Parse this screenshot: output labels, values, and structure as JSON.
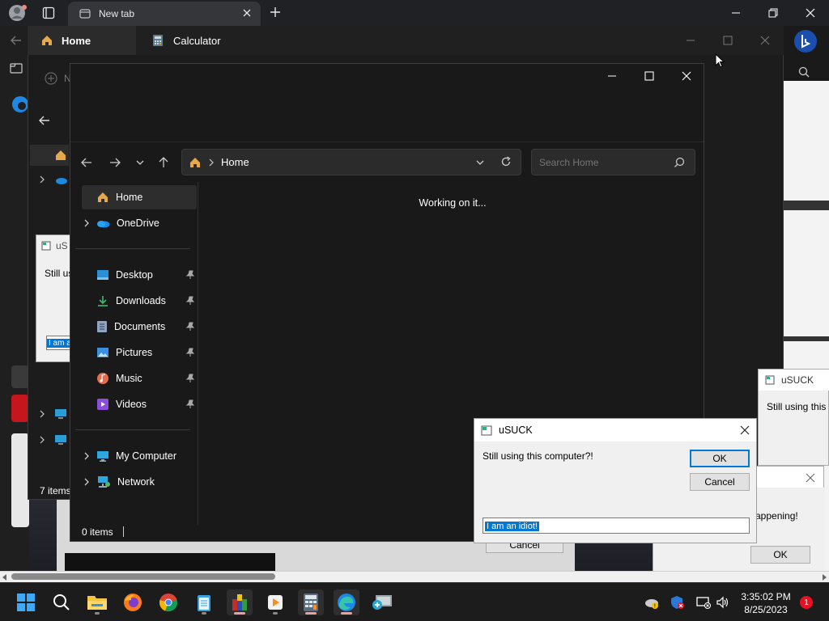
{
  "browser": {
    "tab_title": "New tab",
    "left_partial_label": "N"
  },
  "calculator_window": {
    "home_tab": "Home",
    "title": "Calculator"
  },
  "explorer": {
    "address_location": "Home",
    "search_placeholder": "Search Home",
    "status_text": "Working on it...",
    "item_count": "0 items",
    "nav_items": {
      "home": "Home",
      "onedrive": "OneDrive",
      "desktop": "Desktop",
      "downloads": "Downloads",
      "documents": "Documents",
      "pictures": "Pictures",
      "music": "Music",
      "videos": "Videos",
      "my_computer": "My Computer",
      "network": "Network"
    }
  },
  "background_explorer": {
    "item_count": "7 items"
  },
  "dialog": {
    "title": "uSUCK",
    "message": "Still using this computer?!",
    "ok_label": "OK",
    "cancel_label": "Cancel",
    "input_value": "I am an idiot!"
  },
  "bg_dialog_left": {
    "title": "uS",
    "message": "Still usi",
    "input_value": "I am a"
  },
  "bg_dialog_right": {
    "title": "uSUCK",
    "message": "Still using this co"
  },
  "bg_dialog_right2": {
    "message": "appening!",
    "ok_label": "OK"
  },
  "bg_bottom": {
    "cancel_label": "Cancel"
  },
  "taskbar": {
    "time": "3:35:02 PM",
    "date": "8/25/2023",
    "notification_count": "1"
  },
  "colors": {
    "accent": "#0078d7",
    "explorer_bg": "#191919",
    "taskbar_bg": "#1c1c1c",
    "notification_badge": "#e81123"
  }
}
